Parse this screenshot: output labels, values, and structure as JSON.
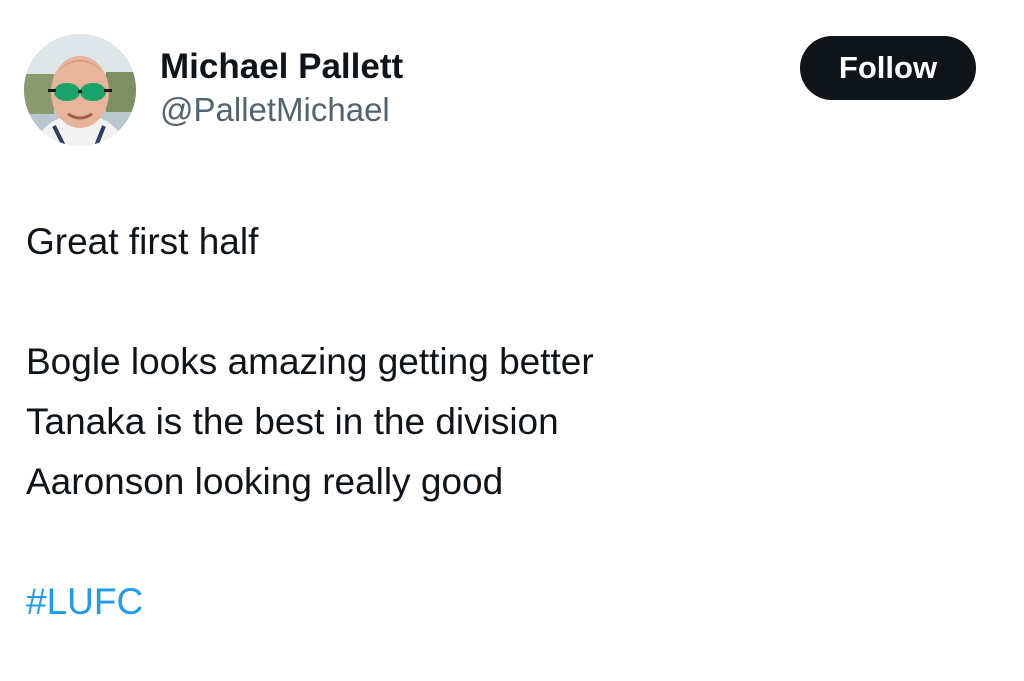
{
  "tweet": {
    "author": {
      "display_name": "Michael Pallett",
      "handle": "@PalletMichael",
      "avatar_icon": "profile-photo"
    },
    "follow_label": "Follow",
    "text_lines": [
      "Great first half",
      "Bogle looks amazing getting better",
      "Tanaka is the best in the division",
      "Aaronson looking really good"
    ],
    "hashtag": "#LUFC"
  },
  "colors": {
    "text": "#0f1419",
    "secondary": "#536471",
    "link": "#1d9bf0",
    "button_bg": "#0f1419",
    "button_text": "#ffffff"
  }
}
